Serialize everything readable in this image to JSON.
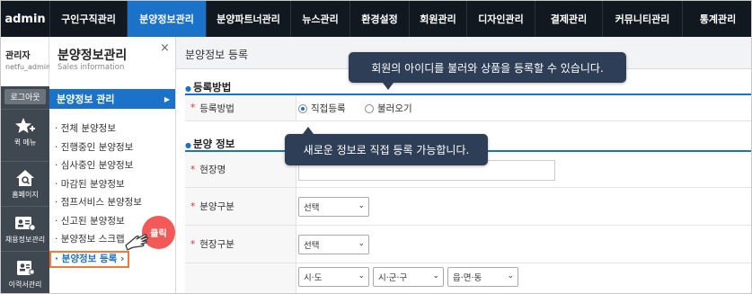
{
  "topnav": {
    "logo": "admin",
    "items": [
      {
        "label": "구인구직관리",
        "active": false
      },
      {
        "label": "분양정보관리",
        "active": true
      },
      {
        "label": "분양파트너관리",
        "active": false
      },
      {
        "label": "뉴스관리",
        "active": false
      },
      {
        "label": "환경설정",
        "active": false
      },
      {
        "label": "회원관리",
        "active": false
      },
      {
        "label": "디자인관리",
        "active": false
      },
      {
        "label": "결제관리",
        "active": false
      },
      {
        "label": "커뮤니티관리",
        "active": false
      },
      {
        "label": "통계관리",
        "active": false
      }
    ]
  },
  "user": {
    "role": "관리자",
    "id": "netfu_admin",
    "logout_label": "로그아웃"
  },
  "iconbar": [
    {
      "label": "퀵 메뉴",
      "icon": "star-plus-icon"
    },
    {
      "label": "홈페이지",
      "icon": "home-search-icon"
    },
    {
      "label": "채용정보관리",
      "icon": "id-card-icon"
    },
    {
      "label": "이력서관리",
      "icon": "resume-icon"
    }
  ],
  "subpanel": {
    "title": "분양정보관리",
    "subtitle": "Sales information",
    "close": "×",
    "section": "분양정보 관리",
    "section_arrow": "▶",
    "items": [
      "전체 분양정보",
      "진행중인 분양정보",
      "심사중인 분양정보",
      "마감된 분양정보",
      "점프서비스 분양정보",
      "신고된 분양정보",
      "분양정보 스크랩"
    ],
    "current": "분양정보 등록",
    "current_arrow": "›"
  },
  "main": {
    "title": "분양정보 등록",
    "section1": "등록방법",
    "row_method": {
      "label": "등록방법",
      "options": [
        {
          "label": "직접등록",
          "checked": true
        },
        {
          "label": "불러오기",
          "checked": false
        }
      ]
    },
    "section2": "분양 정보",
    "fields": {
      "site_name": {
        "label": "현장명",
        "value": ""
      },
      "category": {
        "label": "분양구분",
        "value": "선택"
      },
      "site_type": {
        "label": "현장구분",
        "value": "선택"
      },
      "region": {
        "sido": "시·도",
        "gugun": "시·군·구",
        "dong": "읍·면·동"
      }
    }
  },
  "tooltips": {
    "top": "회원의 아이디를 불러와 상품을 등록할 수 있습니다.",
    "mid": "새로운 정보로 직접 등록 가능합니다."
  },
  "click_badge": "클릭",
  "colors": {
    "nav_bg": "#121820",
    "accent": "#1a73c8",
    "tooltip": "#2f3e57",
    "badge": "#f25a5a",
    "highlight": "#f07a3a"
  }
}
